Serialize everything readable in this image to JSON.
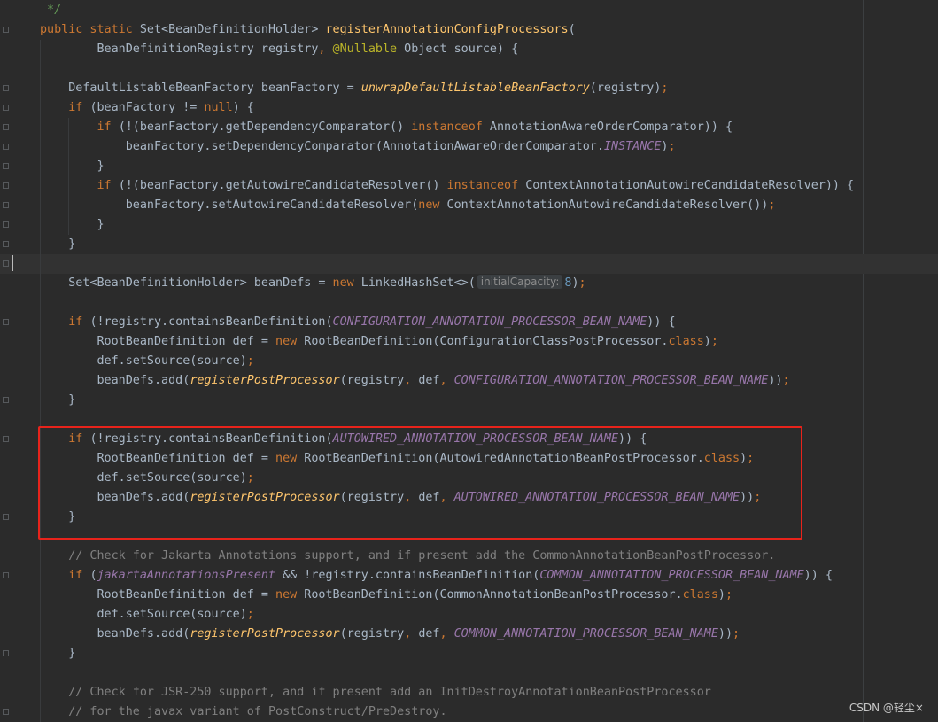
{
  "editor": {
    "lines": [
      {
        "text": [
          {
            "t": " */",
            "c": "doc"
          }
        ]
      },
      {
        "text": [
          {
            "t": "public static ",
            "c": "kw"
          },
          {
            "t": "Set<BeanDefinitionHolder> "
          },
          {
            "t": "registerAnnotationConfigProcessors",
            "c": "fn"
          },
          {
            "t": "("
          }
        ]
      },
      {
        "text": [
          {
            "t": "        BeanDefinitionRegistry registry"
          },
          {
            "t": ", ",
            "c": "kw"
          },
          {
            "t": "@Nullable",
            "c": "ann"
          },
          {
            "t": " Object source) {"
          }
        ]
      },
      {
        "text": []
      },
      {
        "text": [
          {
            "t": "    DefaultListableBeanFactory beanFactory = "
          },
          {
            "t": "unwrapDefaultListableBeanFactory",
            "c": "stat"
          },
          {
            "t": "(registry)"
          },
          {
            "t": ";",
            "c": "kw"
          }
        ]
      },
      {
        "text": [
          {
            "t": "    "
          },
          {
            "t": "if ",
            "c": "kw"
          },
          {
            "t": "(beanFactory != "
          },
          {
            "t": "null",
            "c": "kw"
          },
          {
            "t": ") {"
          }
        ]
      },
      {
        "text": [
          {
            "t": "        "
          },
          {
            "t": "if ",
            "c": "kw"
          },
          {
            "t": "(!(beanFactory.getDependencyComparator() "
          },
          {
            "t": "instanceof ",
            "c": "kw"
          },
          {
            "t": "AnnotationAwareOrderComparator)) {"
          }
        ]
      },
      {
        "text": [
          {
            "t": "            beanFactory.setDependencyComparator(AnnotationAwareOrderComparator."
          },
          {
            "t": "INSTANCE",
            "c": "cst"
          },
          {
            "t": ")"
          },
          {
            "t": ";",
            "c": "kw"
          }
        ]
      },
      {
        "text": [
          {
            "t": "        }"
          }
        ]
      },
      {
        "text": [
          {
            "t": "        "
          },
          {
            "t": "if ",
            "c": "kw"
          },
          {
            "t": "(!(beanFactory.getAutowireCandidateResolver() "
          },
          {
            "t": "instanceof ",
            "c": "kw"
          },
          {
            "t": "ContextAnnotationAutowireCandidateResolver)) {"
          }
        ]
      },
      {
        "text": [
          {
            "t": "            beanFactory.setAutowireCandidateResolver("
          },
          {
            "t": "new ",
            "c": "kw"
          },
          {
            "t": "ContextAnnotationAutowireCandidateResolver())"
          },
          {
            "t": ";",
            "c": "kw"
          }
        ]
      },
      {
        "text": [
          {
            "t": "        }"
          }
        ]
      },
      {
        "text": [
          {
            "t": "    }"
          }
        ]
      },
      {
        "text": [],
        "current": true
      },
      {
        "text": [
          {
            "t": "    Set<BeanDefinitionHolder> beanDefs = "
          },
          {
            "t": "new ",
            "c": "kw"
          },
          {
            "t": "LinkedHashSet<>("
          },
          {
            "t": "initialCapacity:",
            "c": "hint"
          },
          {
            "t": "8",
            "c": "num"
          },
          {
            "t": ")"
          },
          {
            "t": ";",
            "c": "kw"
          }
        ]
      },
      {
        "text": []
      },
      {
        "text": [
          {
            "t": "    "
          },
          {
            "t": "if ",
            "c": "kw"
          },
          {
            "t": "(!registry.containsBeanDefinition("
          },
          {
            "t": "CONFIGURATION_ANNOTATION_PROCESSOR_BEAN_NAME",
            "c": "cst"
          },
          {
            "t": ")) {"
          }
        ]
      },
      {
        "text": [
          {
            "t": "        RootBeanDefinition def = "
          },
          {
            "t": "new ",
            "c": "kw"
          },
          {
            "t": "RootBeanDefinition(ConfigurationClassPostProcessor."
          },
          {
            "t": "class",
            "c": "kw"
          },
          {
            "t": ")"
          },
          {
            "t": ";",
            "c": "kw"
          }
        ]
      },
      {
        "text": [
          {
            "t": "        def.setSource(source)"
          },
          {
            "t": ";",
            "c": "kw"
          }
        ]
      },
      {
        "text": [
          {
            "t": "        beanDefs.add("
          },
          {
            "t": "registerPostProcessor",
            "c": "stat"
          },
          {
            "t": "(registry"
          },
          {
            "t": ", ",
            "c": "kw"
          },
          {
            "t": "def"
          },
          {
            "t": ", ",
            "c": "kw"
          },
          {
            "t": "CONFIGURATION_ANNOTATION_PROCESSOR_BEAN_NAME",
            "c": "cst"
          },
          {
            "t": "))"
          },
          {
            "t": ";",
            "c": "kw"
          }
        ]
      },
      {
        "text": [
          {
            "t": "    }"
          }
        ]
      },
      {
        "text": []
      },
      {
        "text": [
          {
            "t": "    "
          },
          {
            "t": "if ",
            "c": "kw"
          },
          {
            "t": "(!registry.containsBeanDefinition("
          },
          {
            "t": "AUTOWIRED_ANNOTATION_PROCESSOR_BEAN_NAME",
            "c": "cst"
          },
          {
            "t": ")) {"
          }
        ]
      },
      {
        "text": [
          {
            "t": "        RootBeanDefinition def = "
          },
          {
            "t": "new ",
            "c": "kw"
          },
          {
            "t": "RootBeanDefinition(AutowiredAnnotationBeanPostProcessor."
          },
          {
            "t": "class",
            "c": "kw"
          },
          {
            "t": ")"
          },
          {
            "t": ";",
            "c": "kw"
          }
        ]
      },
      {
        "text": [
          {
            "t": "        def.setSource(source)"
          },
          {
            "t": ";",
            "c": "kw"
          }
        ]
      },
      {
        "text": [
          {
            "t": "        beanDefs.add("
          },
          {
            "t": "registerPostProcessor",
            "c": "stat"
          },
          {
            "t": "(registry"
          },
          {
            "t": ", ",
            "c": "kw"
          },
          {
            "t": "def"
          },
          {
            "t": ", ",
            "c": "kw"
          },
          {
            "t": "AUTOWIRED_ANNOTATION_PROCESSOR_BEAN_NAME",
            "c": "cst"
          },
          {
            "t": "))"
          },
          {
            "t": ";",
            "c": "kw"
          }
        ]
      },
      {
        "text": [
          {
            "t": "    }"
          }
        ]
      },
      {
        "text": []
      },
      {
        "text": [
          {
            "t": "    // Check for Jakarta Annotations support, and if present add the CommonAnnotationBeanPostProcessor.",
            "c": "cmt"
          }
        ]
      },
      {
        "text": [
          {
            "t": "    "
          },
          {
            "t": "if ",
            "c": "kw"
          },
          {
            "t": "("
          },
          {
            "t": "jakartaAnnotationsPresent",
            "c": "cst"
          },
          {
            "t": " && !registry.containsBeanDefinition("
          },
          {
            "t": "COMMON_ANNOTATION_PROCESSOR_BEAN_NAME",
            "c": "cst"
          },
          {
            "t": ")) {"
          }
        ]
      },
      {
        "text": [
          {
            "t": "        RootBeanDefinition def = "
          },
          {
            "t": "new ",
            "c": "kw"
          },
          {
            "t": "RootBeanDefinition(CommonAnnotationBeanPostProcessor."
          },
          {
            "t": "class",
            "c": "kw"
          },
          {
            "t": ")"
          },
          {
            "t": ";",
            "c": "kw"
          }
        ]
      },
      {
        "text": [
          {
            "t": "        def.setSource(source)"
          },
          {
            "t": ";",
            "c": "kw"
          }
        ]
      },
      {
        "text": [
          {
            "t": "        beanDefs.add("
          },
          {
            "t": "registerPostProcessor",
            "c": "stat"
          },
          {
            "t": "(registry"
          },
          {
            "t": ", ",
            "c": "kw"
          },
          {
            "t": "def"
          },
          {
            "t": ", ",
            "c": "kw"
          },
          {
            "t": "COMMON_ANNOTATION_PROCESSOR_BEAN_NAME",
            "c": "cst"
          },
          {
            "t": "))"
          },
          {
            "t": ";",
            "c": "kw"
          }
        ]
      },
      {
        "text": [
          {
            "t": "    }"
          }
        ]
      },
      {
        "text": []
      },
      {
        "text": [
          {
            "t": "    // Check for JSR-250 support, and if present add an InitDestroyAnnotationBeanPostProcessor",
            "c": "cmt"
          }
        ]
      },
      {
        "text": [
          {
            "t": "    // for the javax variant of PostConstruct/PreDestroy.",
            "c": "cmt"
          }
        ]
      }
    ]
  },
  "watermark": "CSDN @轻尘×",
  "colors": {
    "background": "#2b2b2b",
    "keyword": "#cc7832",
    "method": "#ffc66d",
    "annotation": "#bbb529",
    "constant": "#9876aa",
    "comment": "#808080",
    "number": "#6897bb",
    "highlight_box": "#e8231b"
  }
}
